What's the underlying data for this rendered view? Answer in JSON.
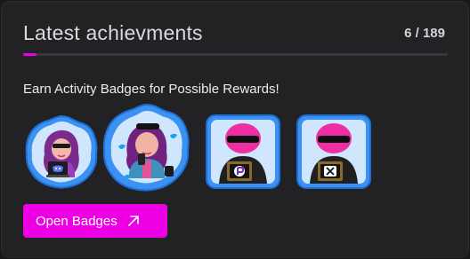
{
  "header": {
    "title": "Latest achievments",
    "count": "6 / 189",
    "progress_fraction": 0.032
  },
  "subtitle": "Earn Activity Badges for Possible Rewards!",
  "badges": [
    {
      "name": "discord-badge",
      "icon": "discord-icon"
    },
    {
      "name": "twitter-badge",
      "icon": "twitter-bird-icon"
    },
    {
      "name": "p-platform-badge",
      "icon": "p-logo-icon"
    },
    {
      "name": "x-badge",
      "icon": "x-logo-icon"
    }
  ],
  "button": {
    "label": "Open Badges",
    "icon": "arrow-up-right-icon"
  },
  "colors": {
    "accent": "#ee00e4",
    "card_bg": "#222224",
    "badge_blue": "#2f8bf0"
  }
}
